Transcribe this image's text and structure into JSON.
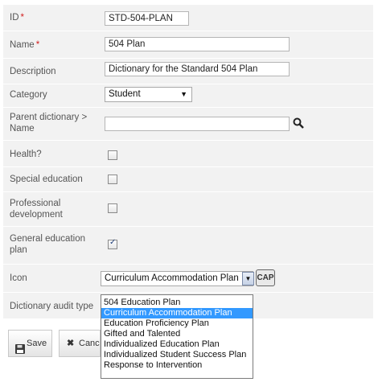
{
  "form": {
    "id": {
      "label": "ID",
      "value": "STD-504-PLAN"
    },
    "name": {
      "label": "Name",
      "value": "504 Plan"
    },
    "description": {
      "label": "Description",
      "value": "Dictionary for the Standard 504 Plan"
    },
    "category": {
      "label": "Category",
      "value": "Student"
    },
    "parent_dictionary": {
      "label_line1": "Parent dictionary >",
      "label_line2": "Name",
      "value": ""
    },
    "health": {
      "label": "Health?",
      "checked": false
    },
    "special_education": {
      "label": "Special education",
      "checked": false
    },
    "professional_development": {
      "label_line1": "Professional",
      "label_line2": "development",
      "checked": false
    },
    "general_education_plan": {
      "label_line1": "General education",
      "label_line2": "plan",
      "checked": true
    },
    "icon": {
      "label": "Icon",
      "value": "Curriculum Accommodation Plan",
      "badge": "CAP"
    },
    "audit_type": {
      "label": "Dictionary audit type"
    },
    "required_marker": "*"
  },
  "icon_options": [
    "504 Education Plan",
    "Curriculum Accommodation Plan",
    "Education Proficiency Plan",
    "Gifted and Talented",
    "Individualized Education Plan",
    "Individualized Student Success Plan",
    "Response to Intervention"
  ],
  "selected_option": "Curriculum Accommodation Plan",
  "buttons": {
    "save": "Save",
    "cancel": "Cance"
  },
  "icons": {
    "search": "search-icon",
    "dropdown": "chevron-down-icon",
    "save": "floppy-disk-icon",
    "cancel": "x-icon",
    "check": "check-icon",
    "cap": "cap-icon"
  },
  "colors": {
    "selection": "#3399ff",
    "required": "#d21f1f",
    "row_bg": "#f2f2f2"
  }
}
